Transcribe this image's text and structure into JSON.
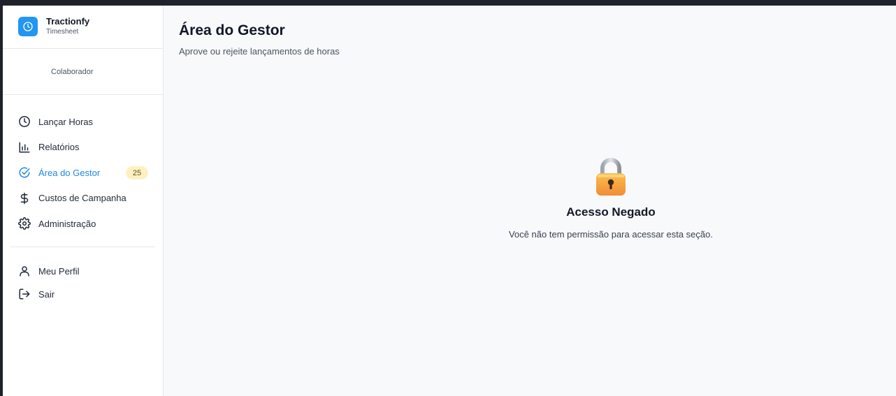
{
  "brand": {
    "name": "Tractionfy",
    "subtitle": "Timesheet",
    "icon": "clock-icon",
    "color": "#2196f3"
  },
  "user": {
    "role": "Colaborador"
  },
  "nav": {
    "items": [
      {
        "label": "Lançar Horas",
        "icon": "clock-icon"
      },
      {
        "label": "Relatórios",
        "icon": "bar-chart-icon"
      },
      {
        "label": "Área do Gestor",
        "icon": "check-circle-icon",
        "badge": "25",
        "active": true
      },
      {
        "label": "Custos de Campanha",
        "icon": "dollar-icon"
      },
      {
        "label": "Administração",
        "icon": "gear-icon"
      }
    ],
    "bottom": [
      {
        "label": "Meu Perfil",
        "icon": "user-icon"
      },
      {
        "label": "Sair",
        "icon": "logout-icon"
      }
    ]
  },
  "page": {
    "title": "Área do Gestor",
    "subtitle": "Aprove ou rejeite lançamentos de horas"
  },
  "denied": {
    "icon": "lock-icon",
    "title": "Acesso Negado",
    "message": "Você não tem permissão para acessar esta seção."
  },
  "colors": {
    "accent": "#1e88e5",
    "badge_bg": "#fdf1c4"
  }
}
